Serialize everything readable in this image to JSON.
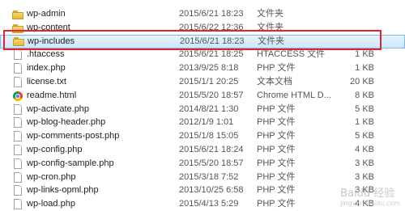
{
  "files": [
    {
      "name": "wp-admin",
      "date": "2015/6/21 18:23",
      "type": "文件夹",
      "size": "",
      "icon": "folder-icon"
    },
    {
      "name": "wp-content",
      "date": "2015/6/22 12:36",
      "type": "文件夹",
      "size": "",
      "icon": "folder-icon"
    },
    {
      "name": "wp-includes",
      "date": "2015/6/21 18:23",
      "type": "文件夹",
      "size": "",
      "icon": "folder-icon"
    },
    {
      "name": ".htaccess",
      "date": "2015/6/21 18:25",
      "type": "HTACCESS 文件",
      "size": "1 KB",
      "icon": "file-icon"
    },
    {
      "name": "index.php",
      "date": "2013/9/25 8:18",
      "type": "PHP 文件",
      "size": "1 KB",
      "icon": "file-icon"
    },
    {
      "name": "license.txt",
      "date": "2015/1/1 20:25",
      "type": "文本文档",
      "size": "20 KB",
      "icon": "file-icon"
    },
    {
      "name": "readme.html",
      "date": "2015/5/20 18:57",
      "type": "Chrome HTML D...",
      "size": "8 KB",
      "icon": "chrome-icon"
    },
    {
      "name": "wp-activate.php",
      "date": "2014/8/21 1:30",
      "type": "PHP 文件",
      "size": "5 KB",
      "icon": "file-icon"
    },
    {
      "name": "wp-blog-header.php",
      "date": "2012/1/9 1:01",
      "type": "PHP 文件",
      "size": "1 KB",
      "icon": "file-icon"
    },
    {
      "name": "wp-comments-post.php",
      "date": "2015/1/8 15:05",
      "type": "PHP 文件",
      "size": "5 KB",
      "icon": "file-icon"
    },
    {
      "name": "wp-config.php",
      "date": "2015/6/21 18:24",
      "type": "PHP 文件",
      "size": "4 KB",
      "icon": "file-icon"
    },
    {
      "name": "wp-config-sample.php",
      "date": "2015/5/20 18:57",
      "type": "PHP 文件",
      "size": "3 KB",
      "icon": "file-icon"
    },
    {
      "name": "wp-cron.php",
      "date": "2015/3/18 7:52",
      "type": "PHP 文件",
      "size": "3 KB",
      "icon": "file-icon"
    },
    {
      "name": "wp-links-opml.php",
      "date": "2013/10/25 6:58",
      "type": "PHP 文件",
      "size": "3 KB",
      "icon": "file-icon"
    },
    {
      "name": "wp-load.php",
      "date": "2015/4/13 5:29",
      "type": "PHP 文件",
      "size": "4 KB",
      "icon": "file-icon"
    }
  ],
  "selected_index": 2,
  "watermark": {
    "text": "Baidu 经验",
    "url": "jingyan.baidu.com"
  },
  "colors": {
    "highlight": "#e8212e",
    "selection": "#cde6fb",
    "folder": "#f2c94c"
  }
}
